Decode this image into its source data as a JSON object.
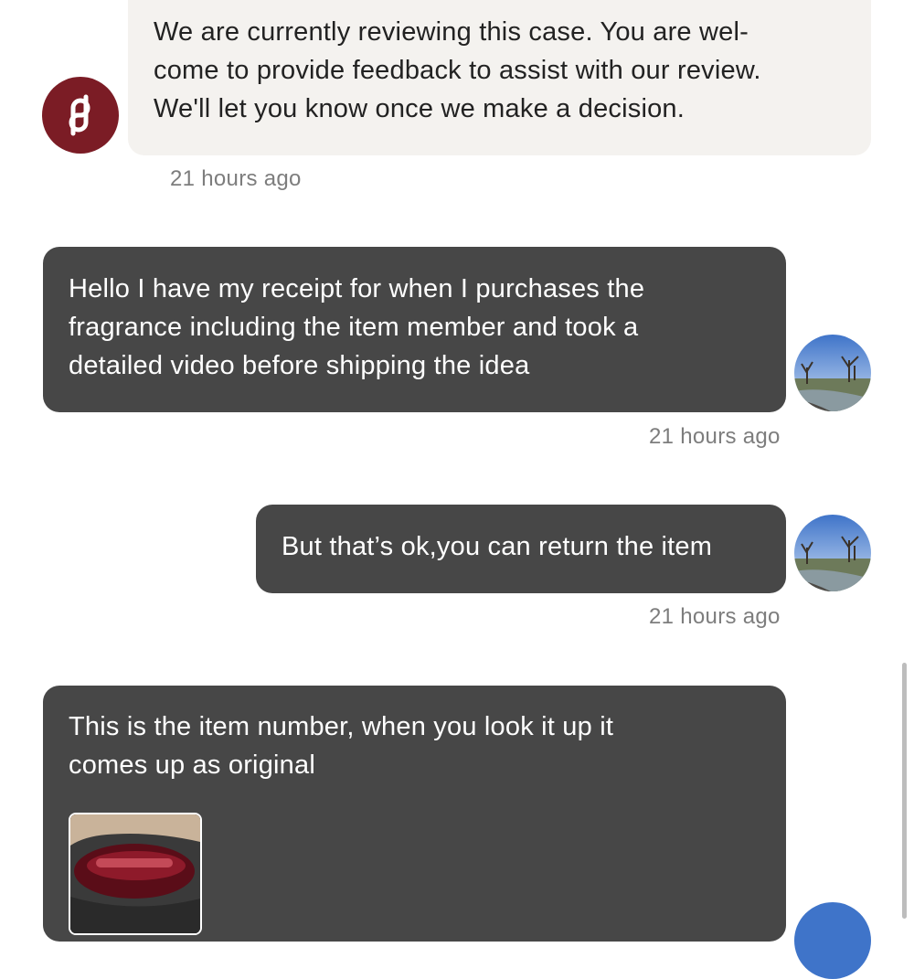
{
  "messages": [
    {
      "sender": "Poshmark",
      "text": "We are currently reviewing this case. You are wel-\ncome to provide feedback to assist with our review.\nWe'll let you know once we make a decision.",
      "time": "21 hours ago"
    },
    {
      "sender": "user",
      "text": "Hello I have my receipt for when I purchases the\nfragrance including the item member and took a\ndetailed video before shipping the idea",
      "time": "21 hours ago"
    },
    {
      "sender": "user",
      "text": "But that’s ok,you can return the item",
      "time": "21 hours ago"
    },
    {
      "sender": "user",
      "text": "This is the item number, when you look it up it\ncomes up as original",
      "attachment_icon": "photo-thumbnail"
    }
  ],
  "colors": {
    "incoming_bubble": "#f4f2ef",
    "outgoing_bubble": "#474747",
    "brand": "#7b1c25",
    "timestamp": "#7d7d7d"
  },
  "icons": {
    "brand_avatar": "poshmark-logo-icon",
    "user_avatar": "landscape-avatar"
  }
}
